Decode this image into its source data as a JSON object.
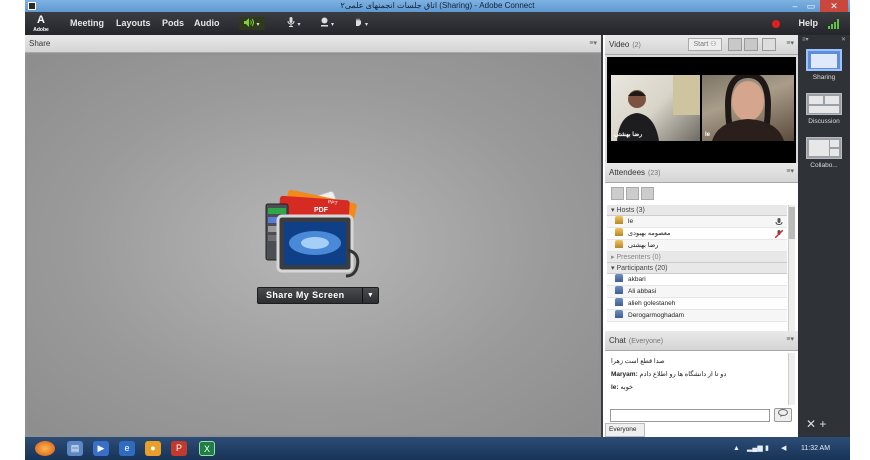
{
  "window": {
    "title": "اتاق جلسات انجمنهای علمی۲ (Sharing) - Adobe Connect",
    "min_glyph": "–",
    "max_glyph": "▭",
    "close_glyph": "✕"
  },
  "menubar": {
    "logo_main": "A",
    "logo_sub": "Adobe",
    "items": [
      "Meeting",
      "Layouts",
      "Pods",
      "Audio"
    ],
    "help_label": "Help"
  },
  "share_pod": {
    "title": "Share",
    "button_label": "Share My Screen",
    "pdf_label": "PDF",
    "ppt_label": "PPT"
  },
  "video_pod": {
    "title": "Video",
    "count": "(2)",
    "start_label": "Start",
    "tiles": [
      {
        "name": "رضا بهشتی"
      },
      {
        "name": "le"
      }
    ]
  },
  "attendees_pod": {
    "title": "Attendees",
    "count": "(23)",
    "hosts_label": "Hosts (3)",
    "hosts": [
      "le",
      "معصومه بهبودی",
      "رضا بهشتی"
    ],
    "presenters_label": "Presenters (0)",
    "participants_label": "Participants (20)",
    "participants": [
      "akbari",
      "Ali abbasi",
      "alieh golestaneh",
      "Derogarmoghadam"
    ]
  },
  "chat_pod": {
    "title": "Chat",
    "scope": "(Everyone)",
    "messages": [
      {
        "sender": "",
        "text": "صدا قطع است زهرا"
      },
      {
        "sender": "Maryam:",
        "text": "دو تا از دانشگاه ها رو اطلاع دادم"
      },
      {
        "sender": "le:",
        "text": "خوبه"
      }
    ],
    "recipient": "Everyone"
  },
  "layouts": {
    "items": [
      {
        "label": "Sharing",
        "active": true
      },
      {
        "label": "Discussion",
        "active": false
      },
      {
        "label": "Collabo...",
        "active": false
      }
    ],
    "bottom_tools": "✕ +"
  },
  "taskbar": {
    "clock": "11:32 AM"
  },
  "colors": {
    "accent": "#5e8fd6",
    "record": "#e0201f",
    "menubar": "#2b2d31"
  }
}
